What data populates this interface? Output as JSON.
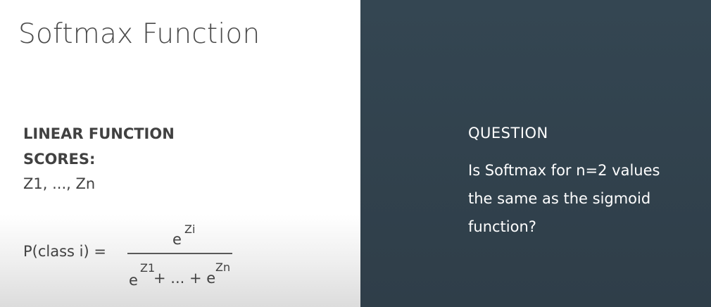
{
  "slide": {
    "title": "Softmax Function"
  },
  "left": {
    "heading": "LINEAR FUNCTION SCORES:",
    "scores": "Z1, ..., Zn",
    "formula": {
      "lhs": "P(class i) =",
      "numerator_base": "e",
      "numerator_exponent": "Zi",
      "denominator_term1_base": "e",
      "denominator_term1_exponent": "Z1",
      "denominator_middle": "+ ... + e",
      "denominator_last_exponent": "Zn"
    }
  },
  "right": {
    "heading": "QUESTION",
    "question": "Is Softmax for n=2 values the same as the sigmoid function?"
  },
  "colors": {
    "left_background": "#ffffff",
    "right_background": "#344652",
    "text_dark": "#414141",
    "text_light": "#ffffff"
  }
}
